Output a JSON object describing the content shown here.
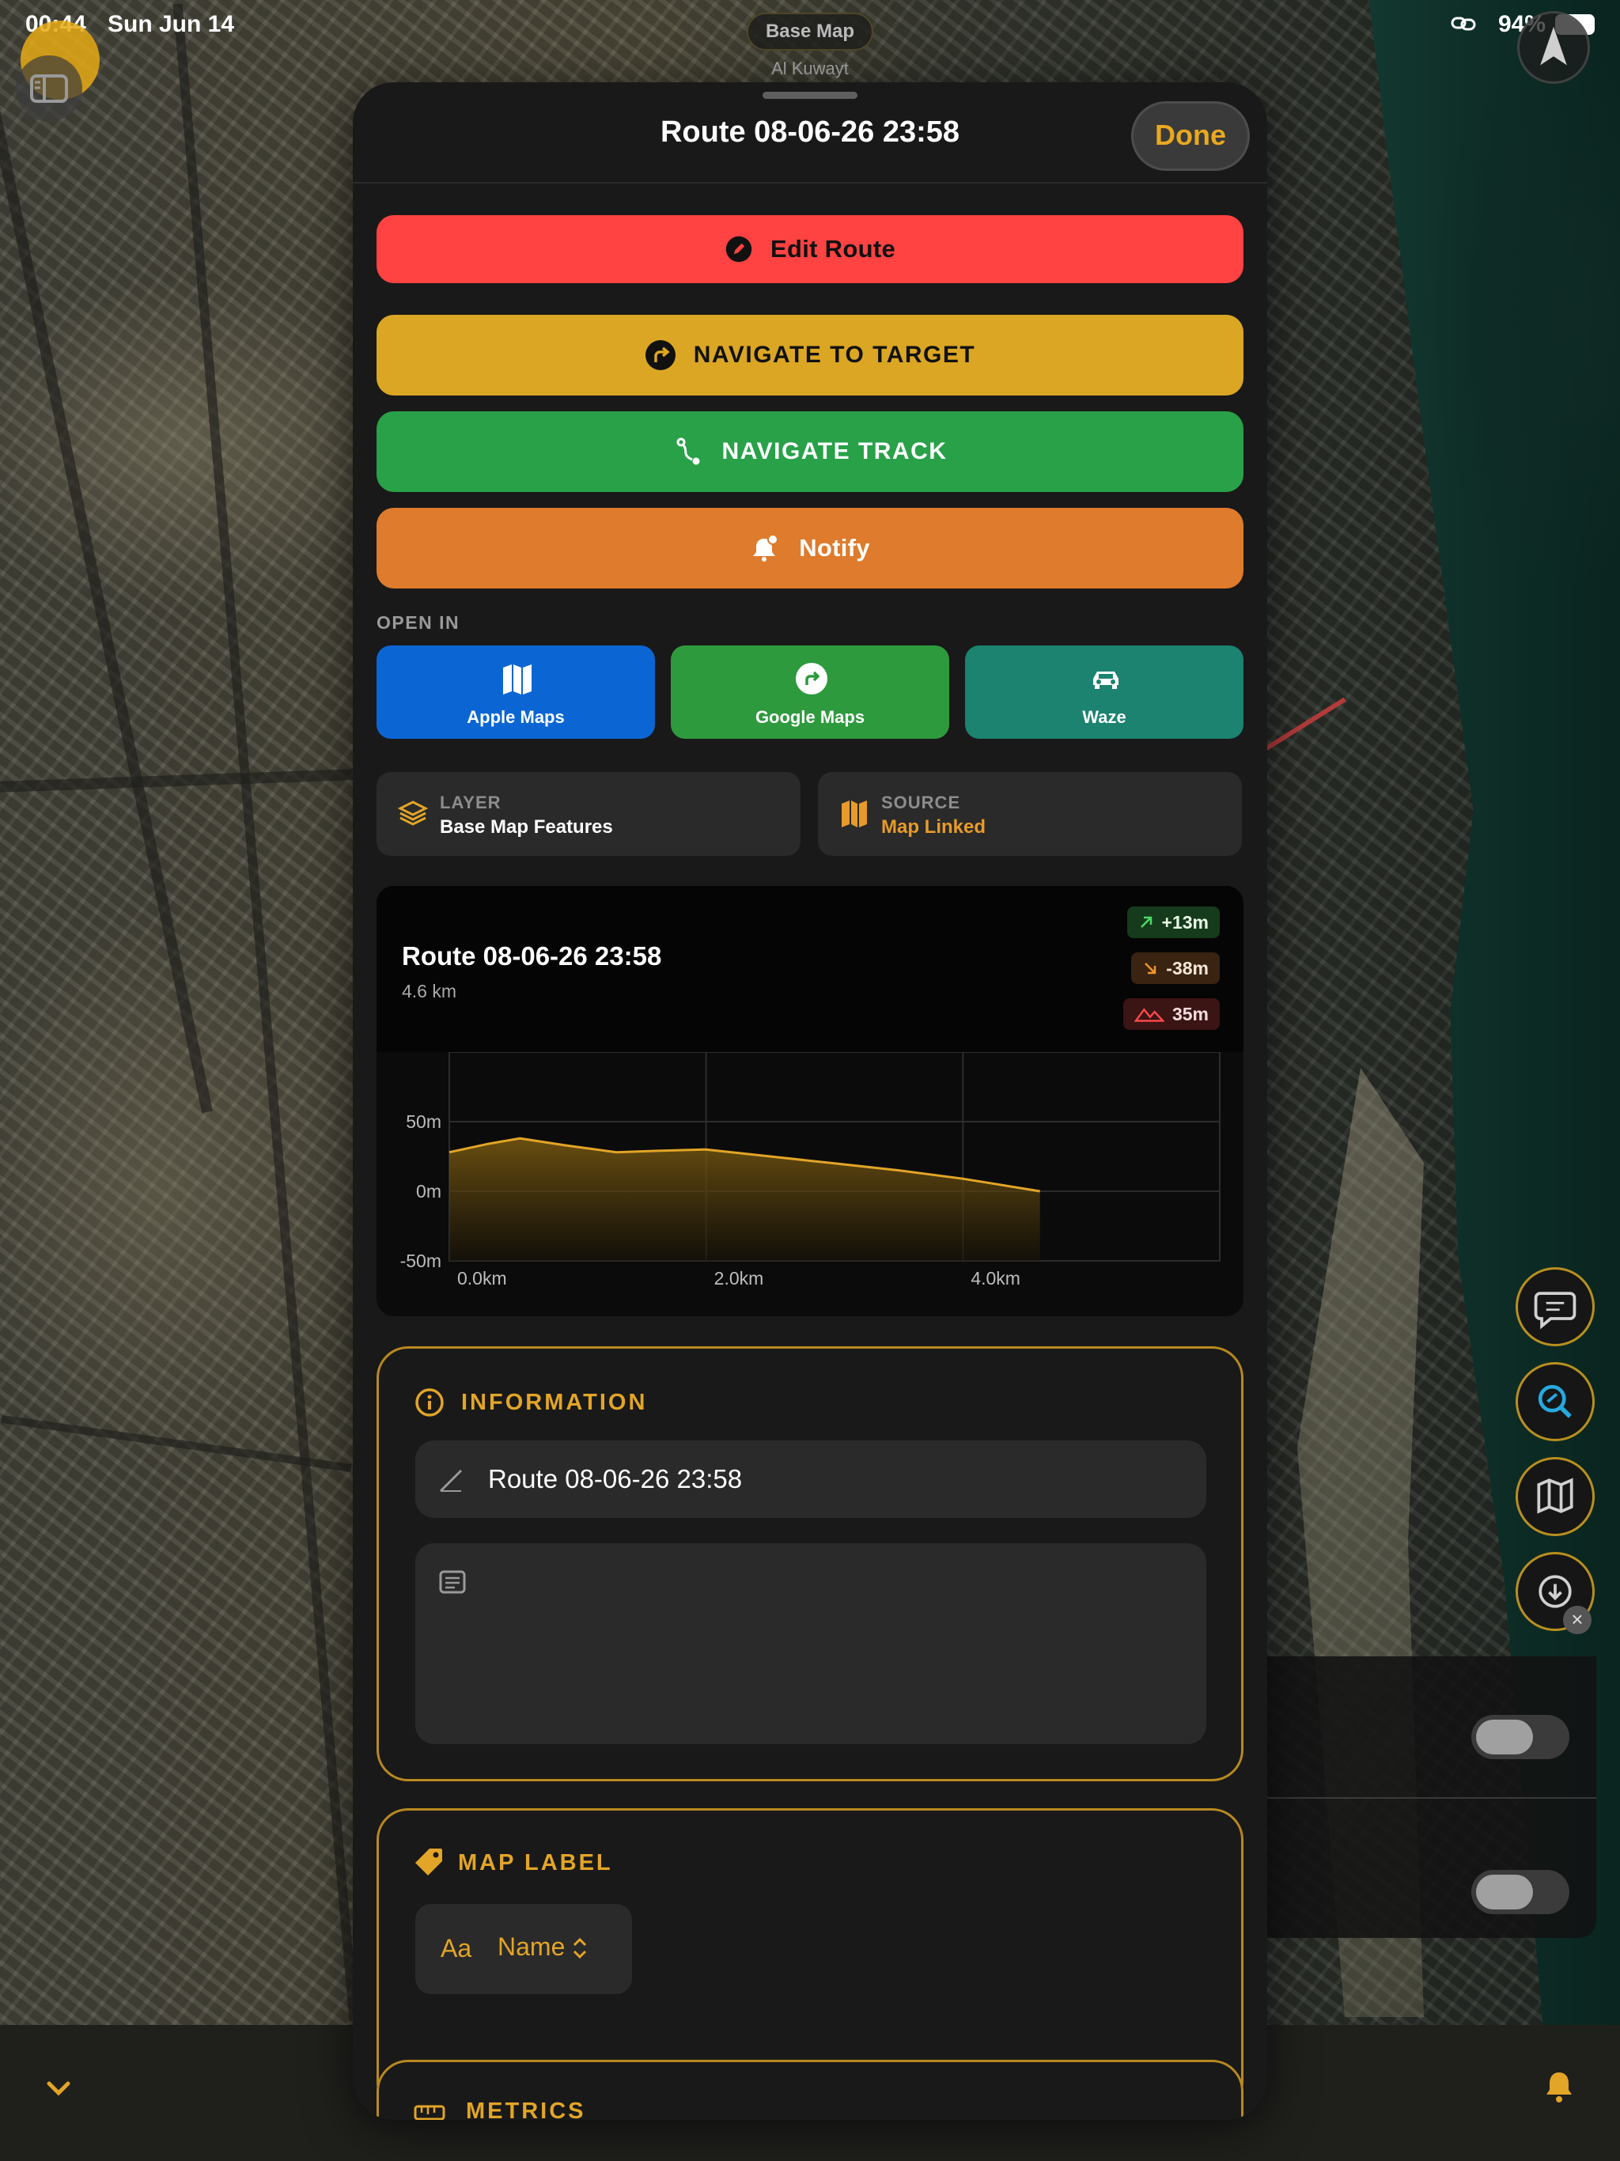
{
  "status_bar": {
    "time": "00:44",
    "date": "Sun Jun 14",
    "battery": "94%"
  },
  "map": {
    "base_map_label": "Base Map",
    "region_label": "Al Kuwayt"
  },
  "sheet": {
    "title": "Route 08-06-26 23:58",
    "done_label": "Done",
    "actions": {
      "edit_route": "Edit Route",
      "navigate_to_target": "NAVIGATE TO TARGET",
      "navigate_track": "NAVIGATE TRACK",
      "notify": "Notify"
    },
    "open_in": {
      "label": "OPEN IN",
      "apple_maps": "Apple Maps",
      "google_maps": "Google Maps",
      "waze": "Waze"
    },
    "layer": {
      "caption": "LAYER",
      "value": "Base Map Features"
    },
    "source": {
      "caption": "SOURCE",
      "value": "Map Linked"
    },
    "elevation": {
      "title": "Route 08-06-26 23:58",
      "distance": "4.6 km",
      "gain": "+13m",
      "loss": "-38m",
      "max": "35m"
    },
    "information": {
      "title": "INFORMATION",
      "name_value": "Route 08-06-26 23:58",
      "notes_value": ""
    },
    "map_label": {
      "title": "MAP LABEL",
      "aa": "Aa",
      "selected": "Name"
    },
    "metrics": {
      "title": "METRICS"
    }
  },
  "colors": {
    "accent": "#e2a527",
    "edit_route": "#ff4242",
    "navigate_target": "#dba623",
    "navigate_track": "#28a148",
    "notify": "#de7b2c",
    "apple_maps": "#0b66d4",
    "google_maps": "#2e9a3e",
    "waze": "#1b8370"
  },
  "chart_data": {
    "type": "area",
    "x": [
      0.0,
      0.3,
      0.55,
      0.9,
      1.3,
      1.6,
      2.0,
      2.5,
      3.0,
      3.5,
      4.0,
      4.6
    ],
    "values": [
      28,
      34,
      38,
      33,
      28,
      29,
      30,
      25,
      20,
      15,
      9,
      0
    ],
    "x_tick_labels": [
      "0.0km",
      "2.0km",
      "4.0km"
    ],
    "y_tick_labels": [
      "50m",
      "0m",
      "-50m"
    ],
    "xlim": [
      0,
      6
    ],
    "ylim": [
      -50,
      100
    ],
    "grid": true,
    "line_color": "#e2a527"
  }
}
